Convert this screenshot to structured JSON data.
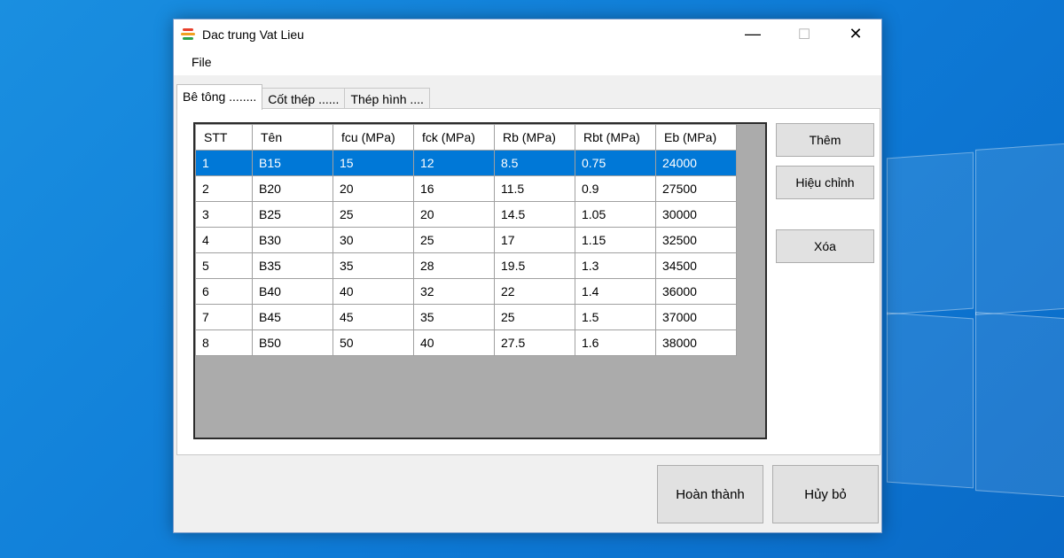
{
  "window": {
    "title": "Dac trung Vat Lieu",
    "minimize_glyph": "—",
    "maximize_glyph": "☐",
    "close_glyph": "✕",
    "icon": "app-logo-icon",
    "icon_colors": [
      "#e8402c",
      "#f0a020",
      "#2aa14a"
    ]
  },
  "menu": {
    "file_label": "File"
  },
  "tabs": [
    {
      "label": "Bê tông ........"
    },
    {
      "label": "Cốt thép ......"
    },
    {
      "label": "Thép hình ...."
    }
  ],
  "table": {
    "columns": [
      "STT",
      "Tên",
      "fcu (MPa)",
      "fck (MPa)",
      "Rb (MPa)",
      "Rbt (MPa)",
      "Eb (MPa)"
    ],
    "rows": [
      [
        "1",
        "B15",
        "15",
        "12",
        "8.5",
        "0.75",
        "24000"
      ],
      [
        "2",
        "B20",
        "20",
        "16",
        "11.5",
        "0.9",
        "27500"
      ],
      [
        "3",
        "B25",
        "25",
        "20",
        "14.5",
        "1.05",
        "30000"
      ],
      [
        "4",
        "B30",
        "30",
        "25",
        "17",
        "1.15",
        "32500"
      ],
      [
        "5",
        "B35",
        "35",
        "28",
        "19.5",
        "1.3",
        "34500"
      ],
      [
        "6",
        "B40",
        "40",
        "32",
        "22",
        "1.4",
        "36000"
      ],
      [
        "7",
        "B45",
        "45",
        "35",
        "25",
        "1.5",
        "37000"
      ],
      [
        "8",
        "B50",
        "50",
        "40",
        "27.5",
        "1.6",
        "38000"
      ]
    ],
    "selected_row": 0,
    "selection_color": "#0078d7"
  },
  "side_buttons": {
    "add_label": "Thêm",
    "edit_label": "Hiệu chỉnh",
    "delete_label": "Xóa"
  },
  "bottom_buttons": {
    "finish_label": "Hoàn thành",
    "cancel_label": "Hủy bỏ"
  }
}
